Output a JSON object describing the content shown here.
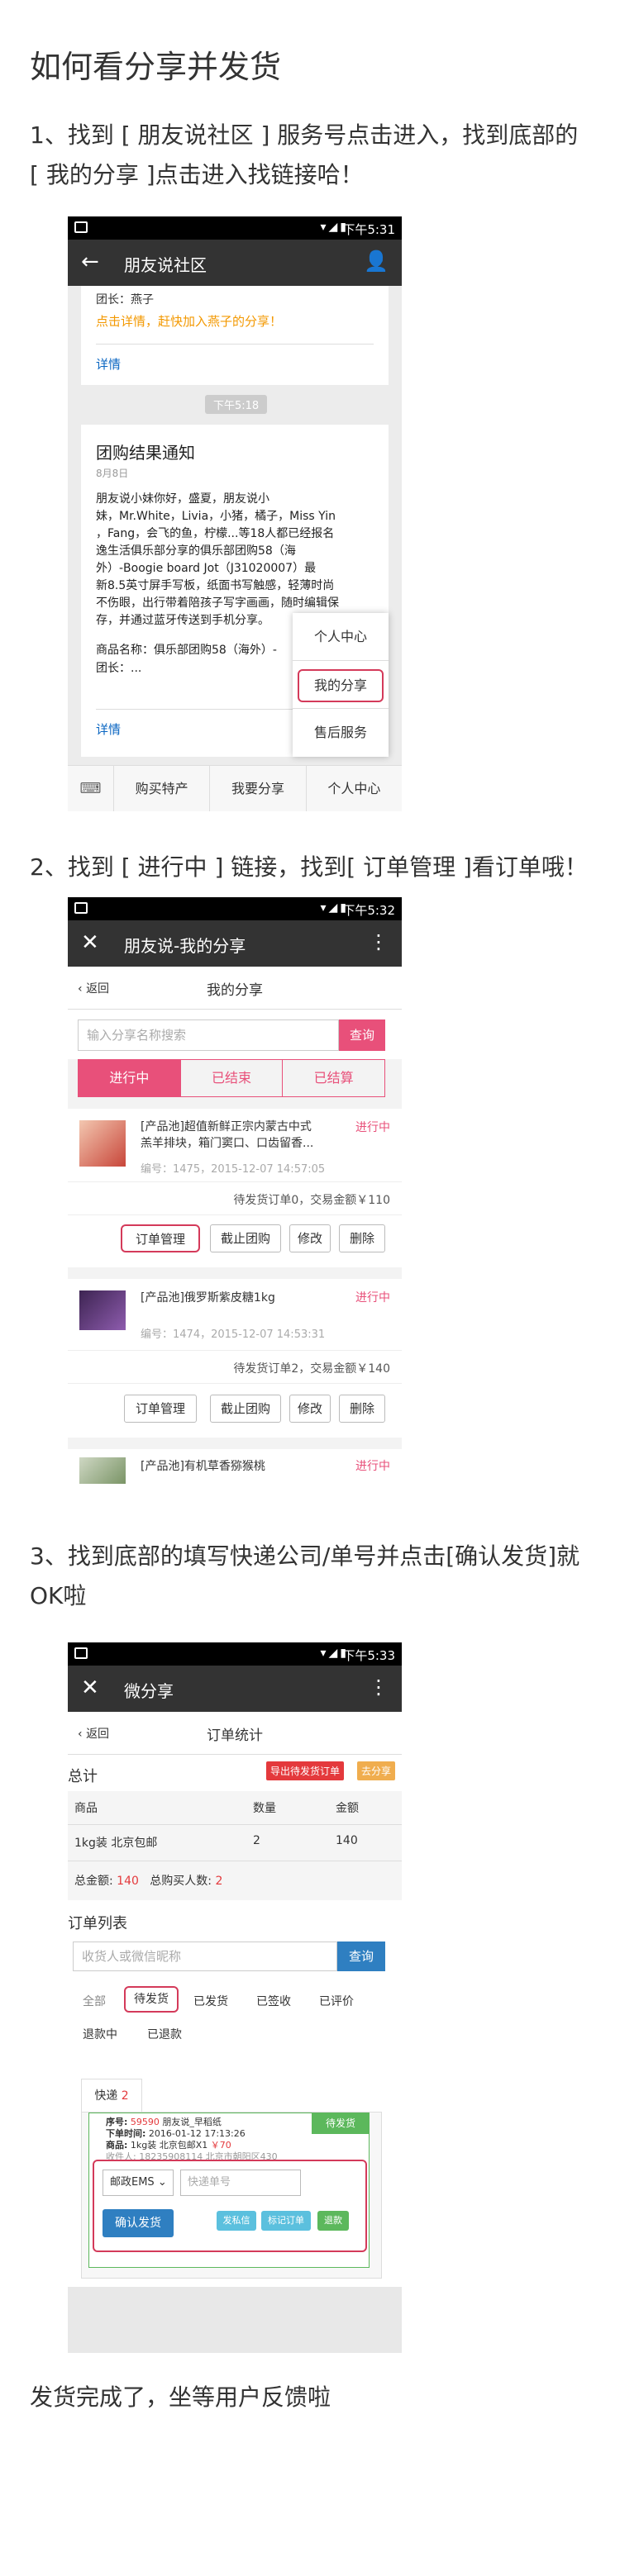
{
  "heading": "如何看分享并发货",
  "step1": {
    "line1": "1、找到 [ 朋友说社区 ] 服务号点击进入，找到底部的",
    "line2": "[ 我的分享 ]点击进入找链接哈！"
  },
  "step2": "2、找到 [ 进行中 ] 链接，找到[ 订单管理 ]看订单哦！",
  "step3": {
    "line1": "3、找到底部的填写快递公司/单号并点击[确认发货]就",
    "line2": "OK啦"
  },
  "footer": "发货完成了，坐等用户反馈啦",
  "ss1": {
    "time": "下午5:31",
    "title": "朋友说社区",
    "top_text1": "团长：燕子",
    "top_text2": "点击详情，赶快加入燕子的分享！",
    "detail": "详情",
    "time_chip": "下午5:18",
    "msg_title": "团购结果通知",
    "msg_date": "8月8日",
    "msg_body": [
      "朋友说小妹你好，盛夏，朋友说小",
      "妹，Mr.White，Livia，小猪，橘子，Miss Yin",
      "，Fang，会飞的鱼，柠檬...等18人都已经报名",
      "逸生活俱乐部分享的俱乐部团购58（海",
      "外）-Boogie board Jot（J31020007）最",
      "新8.5英寸屏手写板，纸面书写触感，轻薄时尚",
      "不伤眼，出行带着陪孩子写字画画，随时编辑保",
      "存，并通过蓝牙传送到手机分享。"
    ],
    "msg_goods": "商品名称：俱乐部团购58（海外）-",
    "msg_leader": "团长：...",
    "detail2": "详情",
    "popup": [
      "个人中心",
      "我的分享",
      "售后服务"
    ],
    "bottom": [
      "购买特产",
      "我要分享",
      "个人中心"
    ]
  },
  "ss2": {
    "time": "下午5:32",
    "title": "朋友说-我的分享",
    "back": "返回",
    "subtitle": "我的分享",
    "search_placeholder": "输入分享名称搜索",
    "search_btn": "查询",
    "tabs": [
      "进行中",
      "已结束",
      "已结算"
    ],
    "items": [
      {
        "status": "进行中",
        "name1": "[产品池]超值新鲜正宗内蒙古中式",
        "name2": "羔羊排块，箱门窦口、口齿留香...",
        "meta": "编号：1475，2015-12-07 14:57:05",
        "summary": "待发货订单0，交易金额￥110"
      },
      {
        "status": "进行中",
        "name1": "[产品池]俄罗斯紫皮糖1kg",
        "name2": "",
        "meta": "编号：1474，2015-12-07 14:53:31",
        "summary": "待发货订单2，交易金额￥140"
      },
      {
        "status": "进行中",
        "name1": "[产品池]有机草香猕猴桃",
        "name2": "",
        "meta": "",
        "summary": ""
      }
    ],
    "actions": [
      "订单管理",
      "截止团购",
      "修改",
      "删除"
    ]
  },
  "ss3": {
    "time": "下午5:33",
    "title": "微分享",
    "back": "返回",
    "subtitle": "订单统计",
    "total_label": "总计",
    "export_btn": "导出待发货订单",
    "share_btn": "去分享",
    "table_headers": [
      "商品",
      "数量",
      "金额"
    ],
    "table_row": [
      "1kg装 北京包邮",
      "2",
      "140"
    ],
    "total_amount_label": "总金额:",
    "total_amount": "140",
    "buyers_label": "总购买人数:",
    "buyers": "2",
    "orders_title": "订单列表",
    "search_placeholder": "收货人或微信昵称",
    "search_btn": "查询",
    "filters": [
      "全部",
      "待发货",
      "已发货",
      "已签收",
      "已评价",
      "退款中",
      "已退款"
    ],
    "express_tab": "快递",
    "express_count": "2",
    "order": {
      "no_label": "序号:",
      "no": "59590",
      "buyer": "朋友说_早稻纸",
      "time_label": "下单时间:",
      "time": "2016-01-12 17:13:26",
      "goods_label": "商品:",
      "goods": "1kg装 北京包邮X1",
      "price": "￥70",
      "addr": "收件人: 18235908114  北京市朝阳区430",
      "ribbon": "待发货"
    },
    "courier_select": "邮政EMS",
    "courier_placeholder": "快递单号",
    "confirm_btn": "确认发货",
    "buttons": [
      "发私信",
      "标记订单",
      "退款"
    ]
  }
}
